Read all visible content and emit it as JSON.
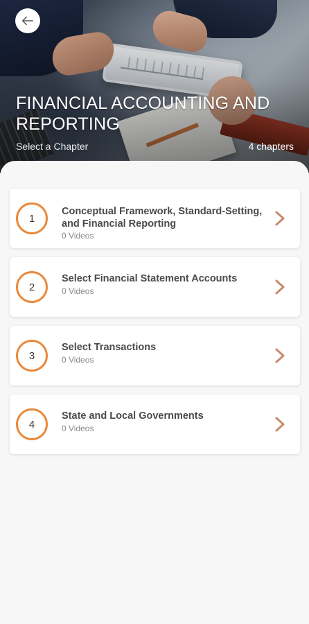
{
  "header": {
    "title": "FINANCIAL ACCOUNTING AND REPORTING",
    "subtitle": "Select a Chapter",
    "chapter_count": "4 chapters",
    "back_icon": "arrow-left-icon"
  },
  "chapters": [
    {
      "number": "1",
      "title": "Conceptual Framework, Standard-Setting, and Financial Reporting",
      "meta": "0 Videos"
    },
    {
      "number": "2",
      "title": "Select Financial Statement Accounts",
      "meta": "0 Videos"
    },
    {
      "number": "3",
      "title": "Select Transactions",
      "meta": "0 Videos"
    },
    {
      "number": "4",
      "title": "State and Local Governments",
      "meta": "0 Videos"
    }
  ],
  "colors": {
    "accent": "#e98a3d",
    "chevron": "#c98a6a",
    "background": "#f7f7f7"
  }
}
